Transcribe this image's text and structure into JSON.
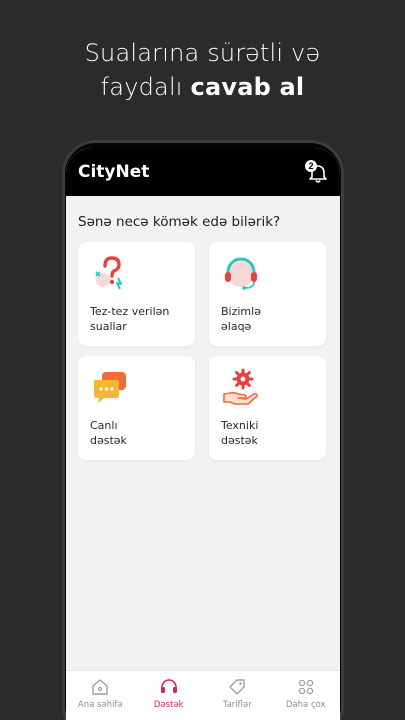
{
  "headline": {
    "line1": "Sualarına sürətli və",
    "line2_prefix": "faydalı",
    "line2_bold": "cavab al"
  },
  "app": {
    "brand": "CityNet",
    "notification_count": "2",
    "prompt": "Sənə necə kömək edə bilərik?"
  },
  "cards": [
    {
      "line1": "Tez-tez verilən",
      "line2": "suallar",
      "icon": "question-bubble-icon"
    },
    {
      "line1": "Bizimlə",
      "line2": "əlaqə",
      "icon": "headset-icon"
    },
    {
      "line1": "Canlı",
      "line2": "dəstək",
      "icon": "chat-bubbles-icon"
    },
    {
      "line1": "Texniki",
      "line2": "dəstək",
      "icon": "gear-hand-icon"
    }
  ],
  "tabs": [
    {
      "label": "Ana səhifə",
      "icon": "home-icon"
    },
    {
      "label": "Dəstək",
      "icon": "headset-icon"
    },
    {
      "label": "Tariflər",
      "icon": "tag-icon"
    },
    {
      "label": "Daha çox",
      "icon": "grid-icon"
    }
  ],
  "colors": {
    "accent": "#d32c4b",
    "icon_red": "#e8413f",
    "icon_teal": "#2ec4c4",
    "icon_yellow": "#f5b731",
    "icon_orange": "#f26b3a"
  }
}
